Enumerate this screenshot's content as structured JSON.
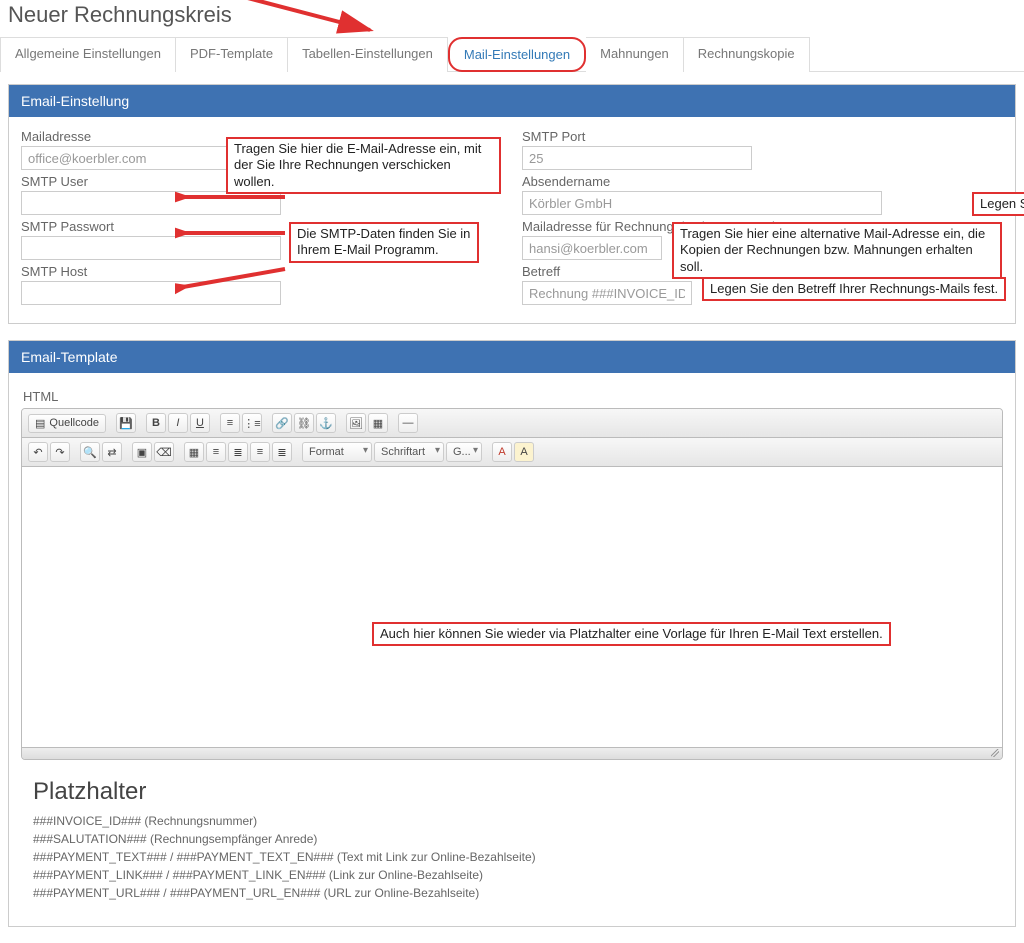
{
  "page_title": "Neuer Rechnungskreis",
  "tabs": [
    {
      "label": "Allgemeine Einstellungen"
    },
    {
      "label": "PDF-Template"
    },
    {
      "label": "Tabellen-Einstellungen"
    },
    {
      "label": "Mail-Einstellungen",
      "active": true,
      "highlighted": true
    },
    {
      "label": "Mahnungen"
    },
    {
      "label": "Rechnungskopie"
    }
  ],
  "email_settings": {
    "header": "Email-Einstellung",
    "left": {
      "mailadresse": {
        "label": "Mailadresse",
        "value": "office@koerbler.com"
      },
      "smtp_user": {
        "label": "SMTP User",
        "value": ""
      },
      "smtp_passwort": {
        "label": "SMTP Passwort",
        "value": ""
      },
      "smtp_host": {
        "label": "SMTP Host",
        "value": ""
      }
    },
    "right": {
      "smtp_port": {
        "label": "SMTP Port",
        "value": "25"
      },
      "absendername": {
        "label": "Absendername",
        "value": "Körbler GmbH"
      },
      "mail_kopien": {
        "label": "Mailadresse für Rechnungs/Mahnungs-Kopien",
        "value": "hansi@koerbler.com"
      },
      "betreff": {
        "label": "Betreff",
        "value": "Rechnung ###INVOICE_ID###"
      }
    },
    "callouts": {
      "c1": "Tragen Sie hier die E-Mail-Adresse ein, mit der Sie Ihre Rechnungen verschicken wollen.",
      "c2": "Die SMTP-Daten finden Sie in Ihrem E-Mail Programm.",
      "c3": "Legen Sie noch den Absendernamen fest.",
      "c4": "Tragen Sie hier eine alternative Mail-Adresse ein, die Kopien der Rechnungen bzw. Mahnungen erhalten soll.",
      "c5": "Legen Sie den Betreff Ihrer Rechnungs-Mails fest."
    }
  },
  "email_template": {
    "header": "Email-Template",
    "html_label": "HTML",
    "toolbar": {
      "quellcode": "Quellcode",
      "format": "Format",
      "schriftart": "Schriftart",
      "groesse": "G..."
    },
    "editor_callout": "Auch hier können Sie wieder via Platzhalter eine Vorlage für Ihren E-Mail Text erstellen."
  },
  "platzhalter": {
    "title": "Platzhalter",
    "items": [
      "###INVOICE_ID### (Rechnungsnummer)",
      "###SALUTATION### (Rechnungsempfänger Anrede)",
      "###PAYMENT_TEXT### / ###PAYMENT_TEXT_EN### (Text mit Link zur Online-Bezahlseite)",
      "###PAYMENT_LINK### / ###PAYMENT_LINK_EN### (Link zur Online-Bezahlseite)",
      "###PAYMENT_URL### / ###PAYMENT_URL_EN### (URL zur Online-Bezahlseite)"
    ]
  },
  "colors": {
    "accent": "#3e72b2",
    "highlight": "#e03030"
  }
}
